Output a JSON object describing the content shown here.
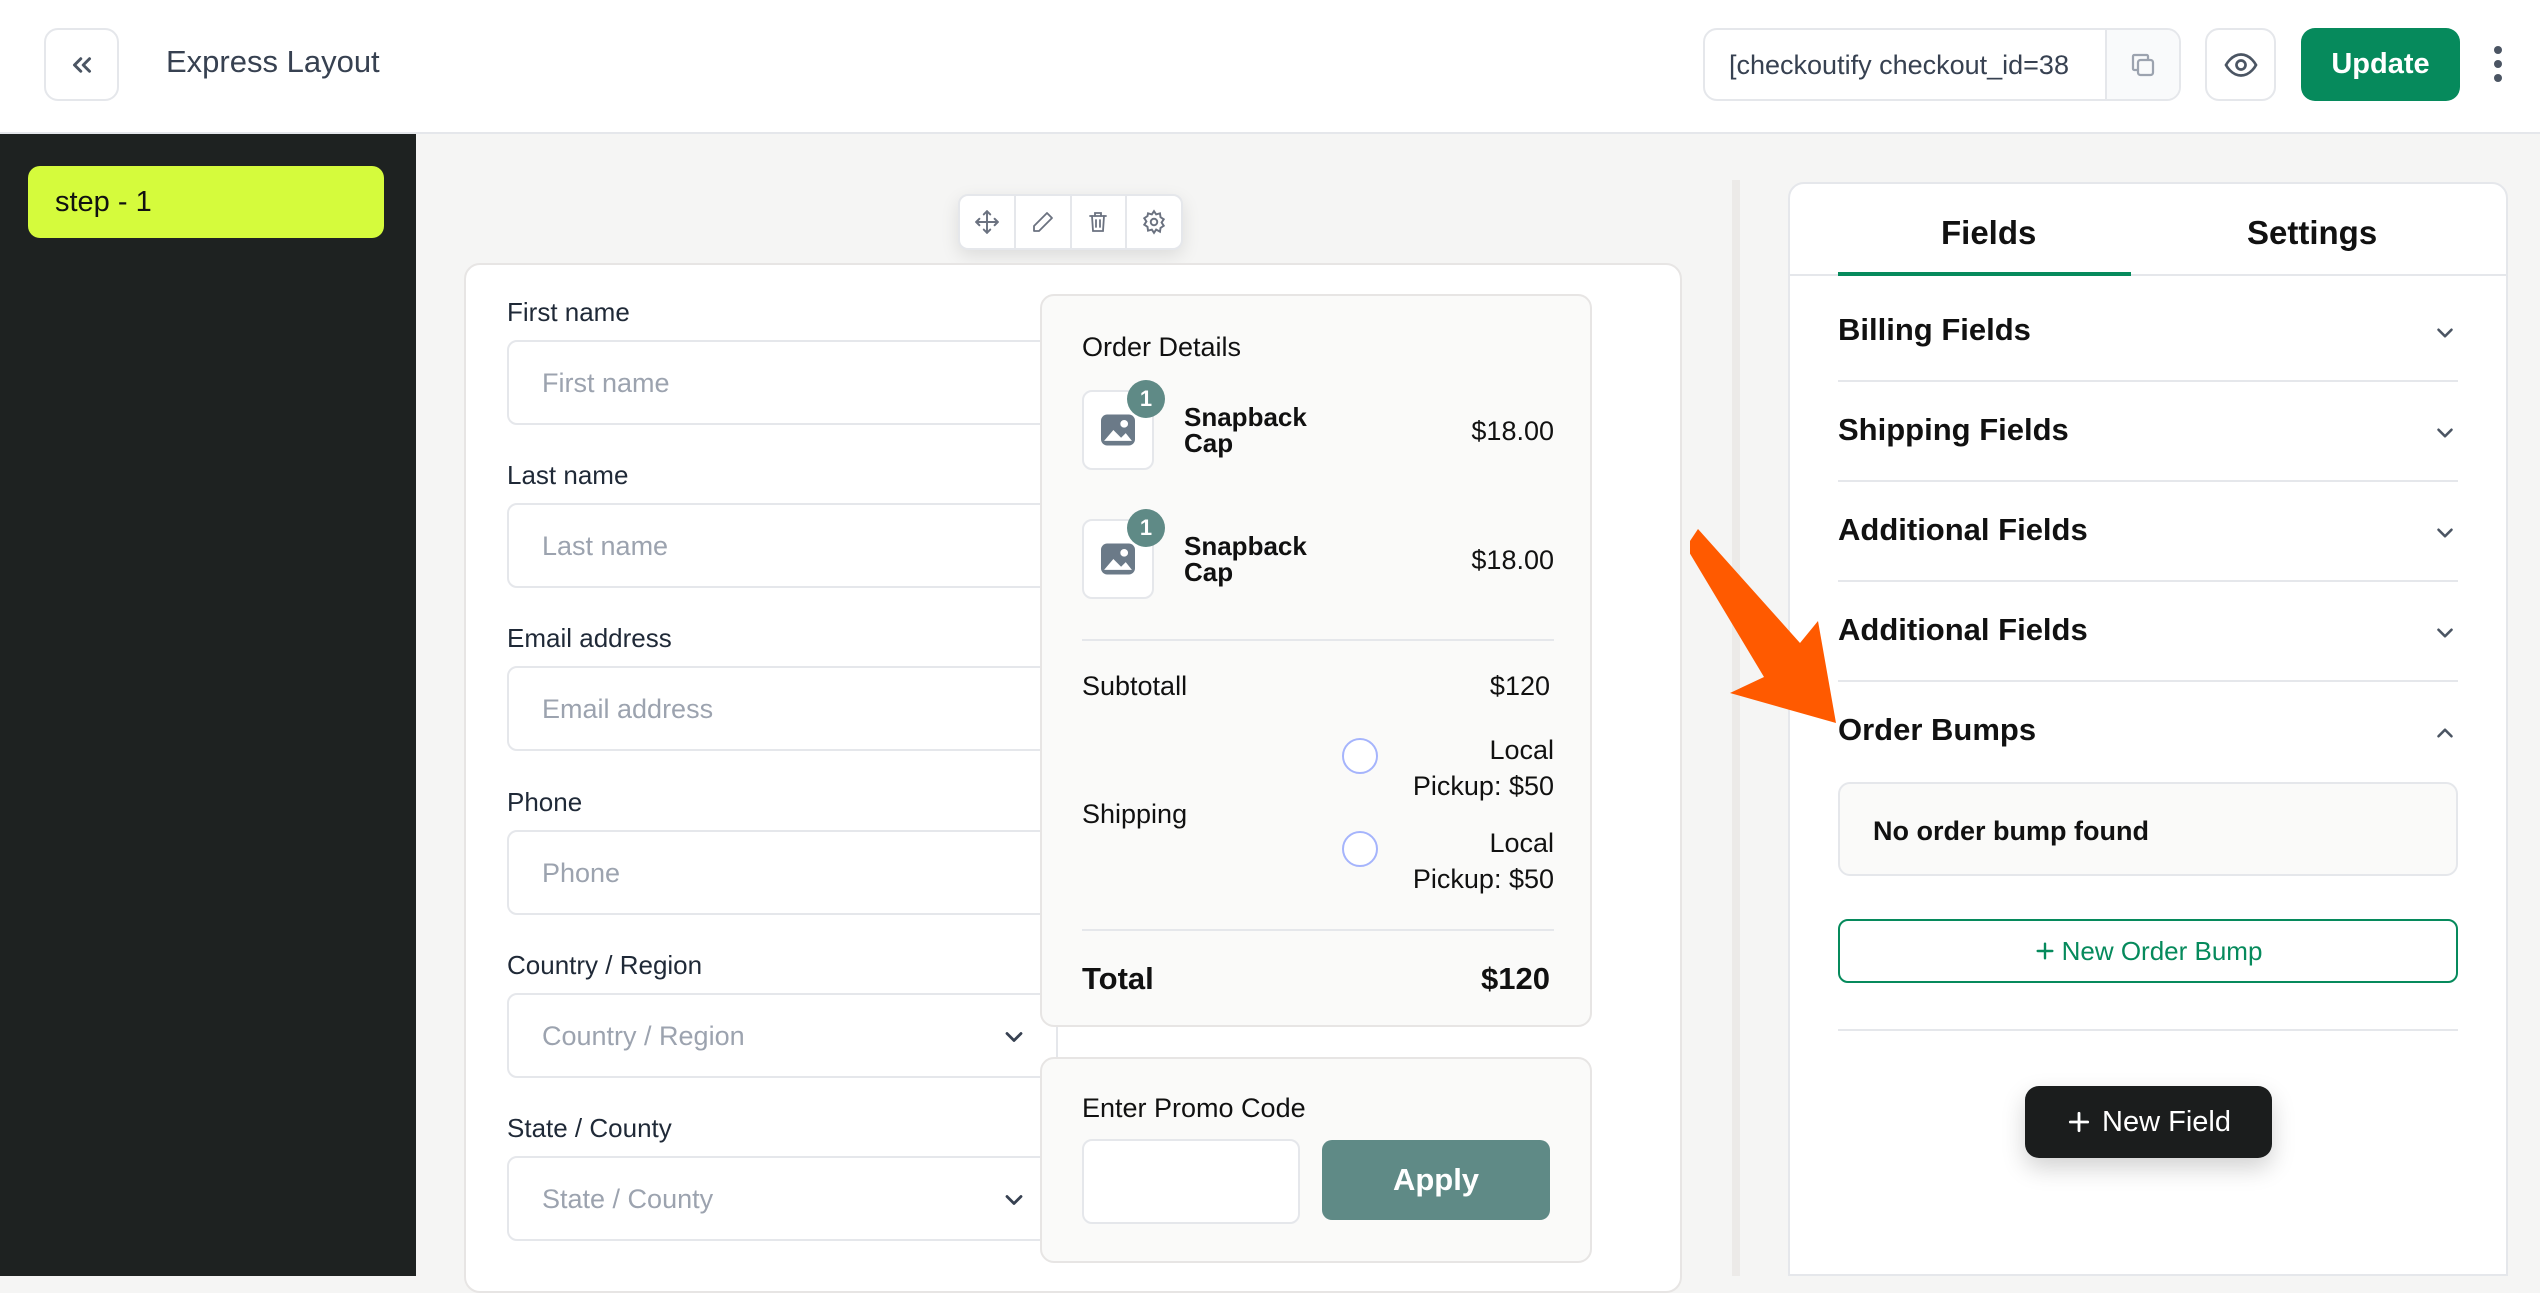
{
  "header": {
    "title": "Express Layout",
    "shortcode": "[checkoutify checkout_id=38",
    "update_label": "Update"
  },
  "sidebar": {
    "steps": [
      {
        "label": "step - 1"
      }
    ]
  },
  "form": {
    "first_name": {
      "label": "First name",
      "placeholder": "First name"
    },
    "last_name": {
      "label": "Last name",
      "placeholder": "Last name"
    },
    "email": {
      "label": "Email address",
      "placeholder": "Email address"
    },
    "phone": {
      "label": "Phone",
      "placeholder": "Phone"
    },
    "country": {
      "label": "Country / Region",
      "placeholder": "Country / Region"
    },
    "state": {
      "label": "State / County",
      "placeholder": "State / County"
    }
  },
  "order": {
    "title": "Order Details",
    "items": [
      {
        "name": "Snapback Cap",
        "qty": "1",
        "price": "$18.00"
      },
      {
        "name": "Snapback Cap",
        "qty": "1",
        "price": "$18.00"
      }
    ],
    "subtotal_label": "Subtotall",
    "subtotal_value": "$120",
    "shipping_label": "Shipping",
    "shipping_options": [
      {
        "line1": "Local",
        "line2": "Pickup: $50"
      },
      {
        "line1": "Local",
        "line2": "Pickup: $50"
      }
    ],
    "total_label": "Total",
    "total_value": "$120"
  },
  "promo": {
    "label": "Enter Promo Code",
    "apply_label": "Apply"
  },
  "panel": {
    "tabs": [
      {
        "label": "Fields",
        "active": true
      },
      {
        "label": "Settings",
        "active": false
      }
    ],
    "sections": [
      {
        "title": "Billing Fields",
        "expanded": false
      },
      {
        "title": "Shipping Fields",
        "expanded": false
      },
      {
        "title": "Additional Fields",
        "expanded": false
      },
      {
        "title": "Additional Fields",
        "expanded": false
      },
      {
        "title": "Order Bumps",
        "expanded": true
      }
    ],
    "empty_order_bump": "No order bump found",
    "new_order_bump_label": "New Order Bump",
    "new_field_label": "New Field"
  },
  "colors": {
    "accent": "#068a5c",
    "step_highlight": "#d5fb3c",
    "sidebar_bg": "#1e2221",
    "apply_bg": "#5f8a86",
    "annotation_arrow": "#ff5a00"
  },
  "icons": [
    "double-chevron-left-icon",
    "copy-icon",
    "eye-icon",
    "more-vertical-icon",
    "move-icon",
    "pencil-icon",
    "trash-icon",
    "gear-icon",
    "image-placeholder-icon",
    "chevron-down-icon",
    "chevron-up-icon",
    "plus-icon"
  ]
}
